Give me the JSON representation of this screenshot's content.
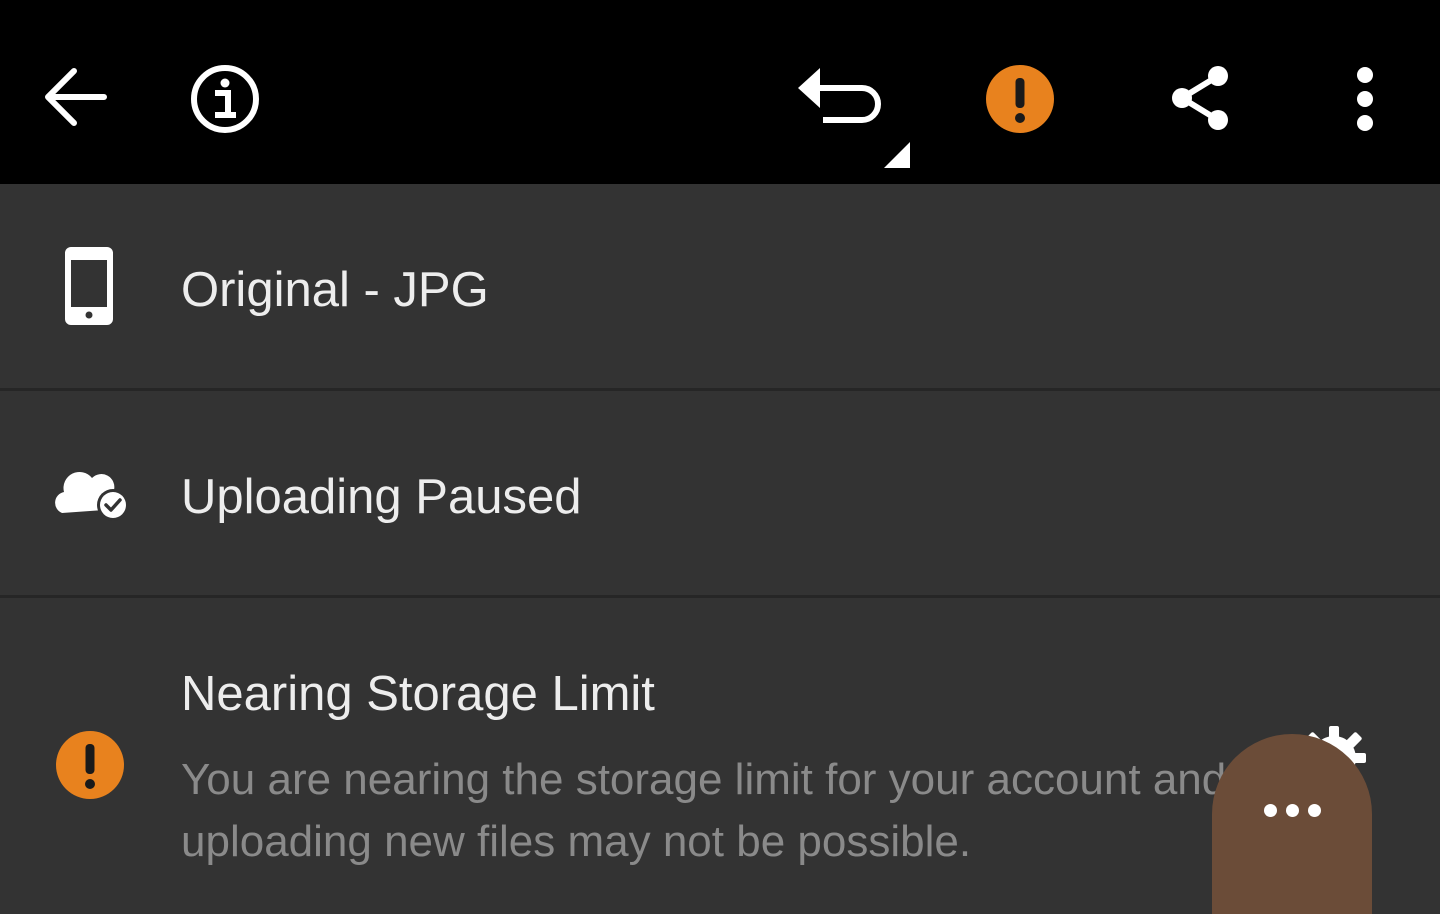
{
  "toolbar": {
    "icons": [
      "back-arrow-icon",
      "info-icon",
      "undo-icon",
      "warning-icon",
      "share-icon",
      "more-vertical-icon"
    ],
    "warning_color": "#e8821e"
  },
  "rows": {
    "original": {
      "label": "Original - JPG",
      "icon": "phone-icon"
    },
    "upload": {
      "label": "Uploading Paused",
      "icon": "cloud-check-icon"
    },
    "storage": {
      "label": "Nearing Storage Limit",
      "description": "You are nearing the storage limit for your account and uploading new files may not be possible.",
      "icon": "warning-icon"
    }
  },
  "fab": {
    "icon": "more-horizontal-icon"
  }
}
